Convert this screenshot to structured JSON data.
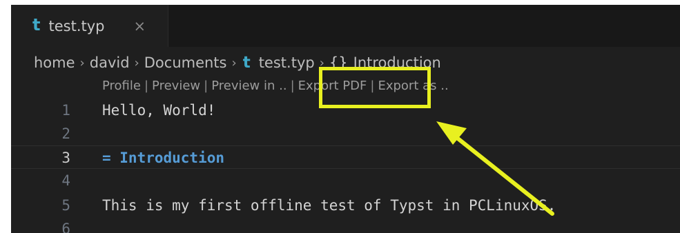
{
  "tab": {
    "icon": "typst-file-icon",
    "icon_glyph": "t",
    "label": "test.typ",
    "close_glyph": "×"
  },
  "breadcrumb": {
    "items": [
      "home",
      "david",
      "Documents",
      "test.typ",
      "Introduction"
    ],
    "separator": "›",
    "symbol_glyph": "{}"
  },
  "codelens": {
    "items": [
      "Profile",
      "Preview",
      "Preview in ..",
      "Export PDF",
      "Export as .."
    ],
    "separator": "|"
  },
  "editor": {
    "active_line": 3,
    "lines": [
      {
        "number": "1",
        "text": "Hello, World!"
      },
      {
        "number": "2",
        "text": ""
      },
      {
        "number": "3",
        "text": "= Introduction"
      },
      {
        "number": "4",
        "text": ""
      },
      {
        "number": "5",
        "text": "This is my first offline test of Typst in PCLinuxOS."
      },
      {
        "number": "6",
        "text": ""
      }
    ]
  },
  "annotation": {
    "color": "#e8f020",
    "target": "Export PDF"
  },
  "colors": {
    "background": "#1f1f1f",
    "tabbar": "#181818",
    "typst_icon": "#3fa9c8",
    "heading": "#569cd6"
  }
}
